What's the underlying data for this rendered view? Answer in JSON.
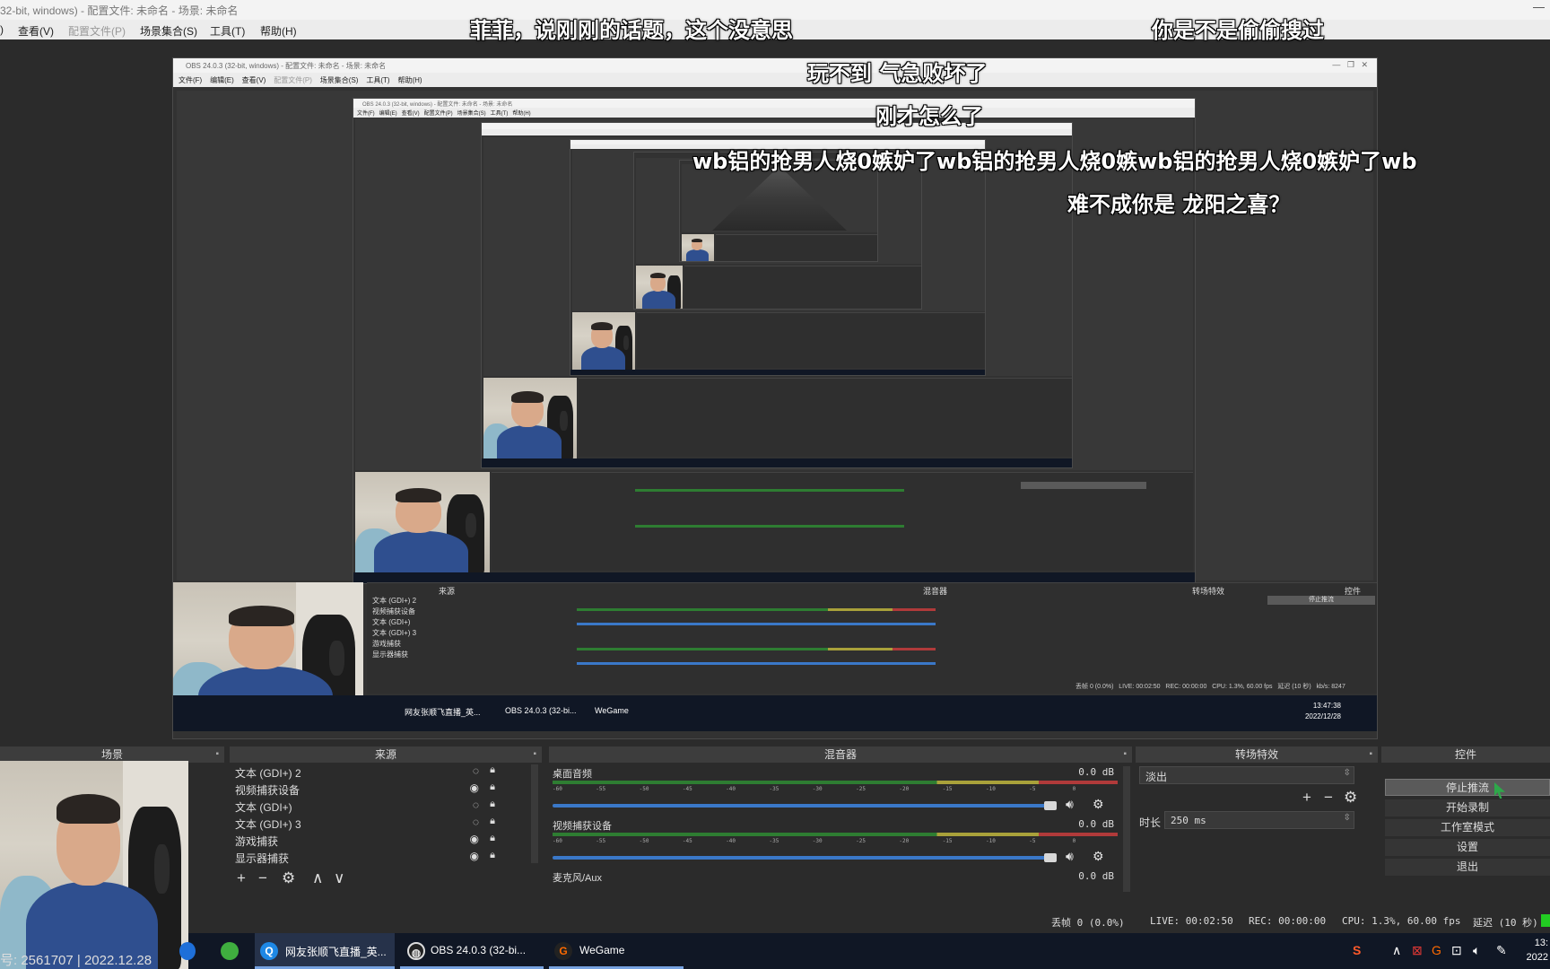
{
  "window": {
    "title": "OBS 24.0.3 (32-bit, windows) - 配置文件: 未命名 - 场景: 未命名",
    "title_visible": "32-bit, windows) - 配置文件: 未命名 - 场景: 未命名",
    "controls": [
      "—",
      "❐",
      "✕"
    ]
  },
  "menu": {
    "items": [
      {
        "label": "查看(V)",
        "enabled": true
      },
      {
        "label": "配置文件(P)",
        "enabled": false
      },
      {
        "label": "场景集合(S)",
        "enabled": true
      },
      {
        "label": "工具(T)",
        "enabled": true
      },
      {
        "label": "帮助(H)",
        "enabled": true
      }
    ],
    "edge_fragment": ")"
  },
  "danmaku": [
    {
      "text": "菲菲，说刚刚的话题，这个没意思"
    },
    {
      "text": "你是不是偷偷搜过"
    },
    {
      "text": "玩不到 气急败坏了"
    },
    {
      "text": "刚才怎么了"
    },
    {
      "text": "wb铝的抢男人烧0嫉妒了wb铝的抢男人烧0嫉wb铝的抢男人烧0嫉妒了wb"
    },
    {
      "text": "难不成你是 龙阳之喜？"
    }
  ],
  "docks": {
    "scenes": {
      "title": "场景"
    },
    "sources": {
      "title": "来源",
      "items": [
        {
          "label": "文本 (GDI+) 2",
          "visible": false
        },
        {
          "label": "视频捕获设备",
          "visible": true
        },
        {
          "label": "文本 (GDI+)",
          "visible": false
        },
        {
          "label": "文本 (GDI+) 3",
          "visible": false
        },
        {
          "label": "游戏捕获",
          "visible": true
        },
        {
          "label": "显示器捕获",
          "visible": true
        }
      ],
      "toolbar": [
        "+",
        "−",
        "⚙",
        "∧",
        "∨"
      ]
    },
    "mixer": {
      "title": "混音器",
      "channels": [
        {
          "name": "桌面音频",
          "db": "0.0 dB"
        },
        {
          "name": "视频捕获设备",
          "db": "0.0 dB"
        },
        {
          "name": "麦克风/Aux",
          "db": "0.0 dB"
        }
      ],
      "ticks": [
        "-60",
        "-55",
        "-50",
        "-45",
        "-40",
        "-35",
        "-30",
        "-25",
        "-20",
        "-15",
        "-10",
        "-5",
        "0"
      ]
    },
    "transitions": {
      "title": "转场特效",
      "selected": "淡出",
      "duration_label": "时长",
      "duration_value": "250 ms"
    },
    "controls": {
      "title": "控件",
      "buttons": [
        {
          "label": "停止推流",
          "active": true
        },
        {
          "label": "开始录制",
          "active": false
        },
        {
          "label": "工作室模式",
          "active": false
        },
        {
          "label": "设置",
          "active": false
        },
        {
          "label": "退出",
          "active": false
        }
      ]
    }
  },
  "statusbar": {
    "dropped": "丢帧 0 (0.0%)",
    "live": "LIVE: 00:02:50",
    "rec": "REC: 00:00:00",
    "cpu": "CPU: 1.3%, 60.00 fps",
    "delay": "延迟 (10 秒)"
  },
  "nested_status": {
    "dropped": "丢帧 0 (0.0%)",
    "live": "LIVE: 00:02:50",
    "rec": "REC: 00:00:00",
    "cpu": "CPU: 1.3%, 60.00 fps",
    "delay": "延迟 (10 秒)",
    "kbps": "kb/s: 8247",
    "time": "13:47:38",
    "date": "2022/12/28"
  },
  "taskbar": {
    "room_info": "号: 2561707 | 2022.12.28",
    "apps": [
      {
        "label": "网友张顺飞直播_英...",
        "icon": "browser-icon"
      },
      {
        "label": "OBS 24.0.3 (32-bi...",
        "icon": "obs-icon"
      },
      {
        "label": "WeGame",
        "icon": "wegame-icon"
      }
    ],
    "clock_time": "13:",
    "clock_date": "2022"
  }
}
